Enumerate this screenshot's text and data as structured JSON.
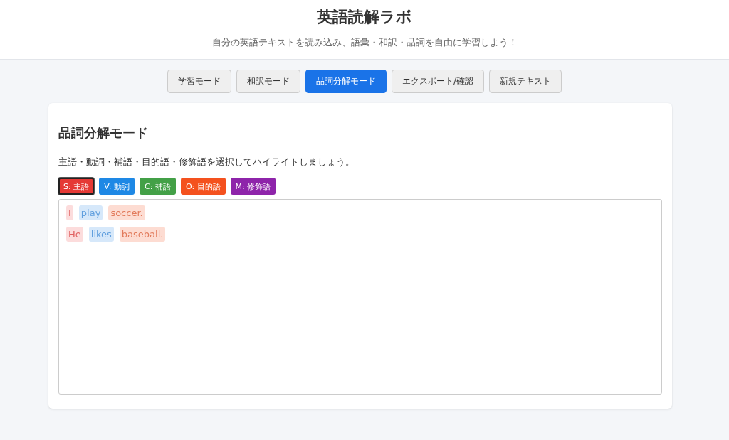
{
  "header": {
    "title": "英語読解ラボ",
    "subtitle": "自分の英語テキストを読み込み、語彙・和訳・品詞を自由に学習しよう！"
  },
  "tabs": [
    {
      "label": "学習モード",
      "selected": false
    },
    {
      "label": "和訳モード",
      "selected": false
    },
    {
      "label": "品詞分解モード",
      "selected": true
    },
    {
      "label": "エクスポート/確認",
      "selected": false
    },
    {
      "label": "新規テキスト",
      "selected": false
    }
  ],
  "panel": {
    "heading": "品詞分解モード",
    "instruction": "主語・動詞・補語・目的語・修飾語を選択してハイライトしましょう。",
    "tags": [
      {
        "label": "S: 主語",
        "color": "#e53935",
        "selected": true
      },
      {
        "label": "V: 動詞",
        "color": "#1e88e5",
        "selected": false
      },
      {
        "label": "C: 補語",
        "color": "#43a047",
        "selected": false
      },
      {
        "label": "O: 目的語",
        "color": "#f4511e",
        "selected": false
      },
      {
        "label": "M: 修飾語",
        "color": "#8e24aa",
        "selected": false
      }
    ],
    "sentences": [
      {
        "words": [
          {
            "text": "I",
            "color": "#fcdcdc"
          },
          {
            "text": "play",
            "color": "#d6e8fa"
          },
          {
            "text": "soccer.",
            "color": "#fddcd2"
          }
        ]
      },
      {
        "words": [
          {
            "text": "He",
            "color": "#fcdcdc"
          },
          {
            "text": "likes",
            "color": "#d6e8fa"
          },
          {
            "text": "baseball.",
            "color": "#fddcd2"
          }
        ]
      }
    ]
  }
}
